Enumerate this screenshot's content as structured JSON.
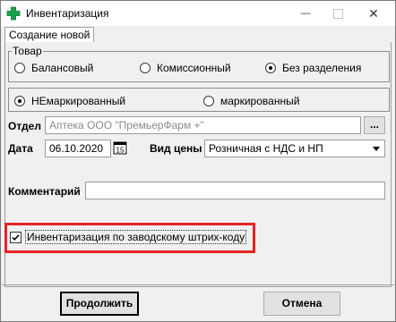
{
  "window": {
    "title": "Инвентаризация",
    "minimize_glyph": "—",
    "close_glyph": "✕",
    "icon": "green-plus-icon",
    "accent_color": "#19a24a"
  },
  "tab": {
    "label": "Создание новой"
  },
  "tovar": {
    "legend": "Товар",
    "options": [
      "Балансовый",
      "Комиссионный",
      "Без разделения"
    ],
    "selected": "Без разделения"
  },
  "marking": {
    "options": [
      "НЕмаркированный",
      "маркированный"
    ],
    "selected": "НЕмаркированный"
  },
  "otdel": {
    "label": "Отдел",
    "value": "Аптека ООО \"ПремьерФарм +\"",
    "browse_label": "..."
  },
  "date": {
    "label": "Дата",
    "value": "06.10.2020",
    "calendar_icon": "calendar-icon",
    "calendar_glyph": "15"
  },
  "price_type": {
    "label": "Вид цены",
    "value": "Розничная с НДС и НП"
  },
  "comment": {
    "label": "Комментарий",
    "value": ""
  },
  "barcode_checkbox": {
    "label": "Инвентаризация по заводскому штрих-коду",
    "checked": true,
    "highlight_color": "#e52424"
  },
  "buttons": {
    "continue": "Продолжить",
    "cancel": "Отмена"
  }
}
